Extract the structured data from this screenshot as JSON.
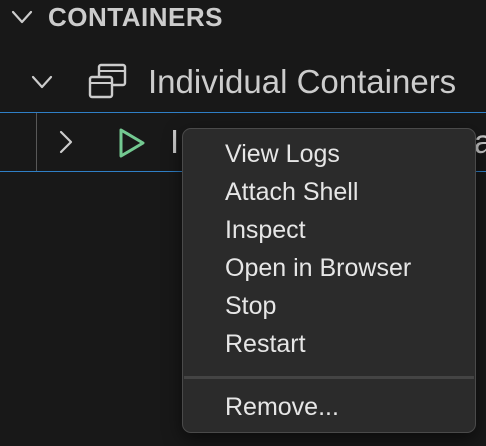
{
  "section": {
    "title": "CONTAINERS"
  },
  "group": {
    "label": "Individual Containers"
  },
  "item": {
    "label": "I",
    "label_tail": "a"
  },
  "context_menu": {
    "items": [
      "View Logs",
      "Attach Shell",
      "Inspect",
      "Open in Browser",
      "Stop",
      "Restart"
    ],
    "remove_label": "Remove..."
  },
  "colors": {
    "background": "#181818",
    "selection_border": "#2f7fc6",
    "running_icon": "#73c991",
    "menu_background": "#2b2b2b"
  },
  "icons": {
    "section_chevron": "chevron-down-icon",
    "group_chevron": "chevron-down-icon",
    "group_icon": "group-windows-icon",
    "item_chevron": "chevron-right-icon",
    "item_status": "play-icon"
  }
}
